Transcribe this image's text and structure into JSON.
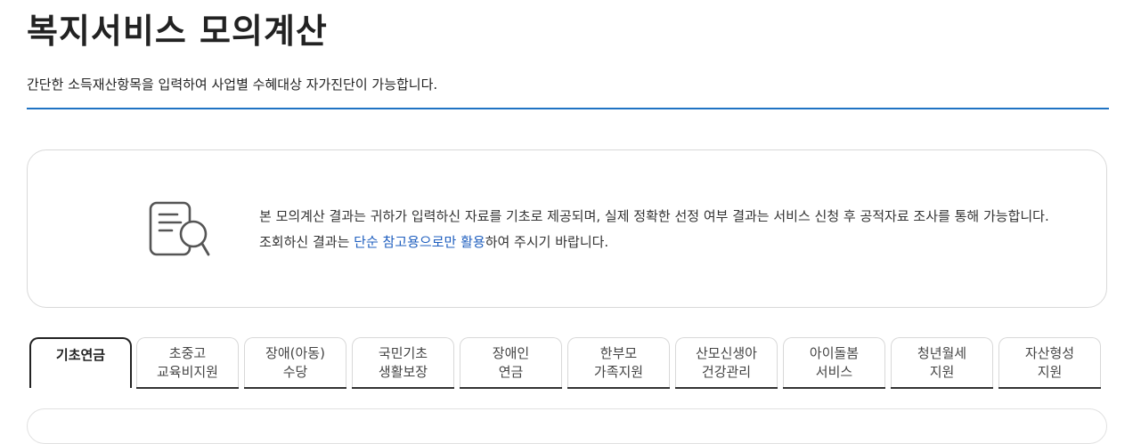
{
  "page": {
    "title": "복지서비스 모의계산",
    "subtitle": "간단한 소득재산항목을 입력하여 사업별 수혜대상 자가진단이 가능합니다."
  },
  "notice": {
    "icon": "document-search-icon",
    "text_before": "본 모의계산 결과는 귀하가 입력하신 자료를 기초로 제공되며, 실제 정확한 선정 여부 결과는 서비스 신청 후 공적자료 조사를 통해 가능합니다. 조회하신 결과는 ",
    "text_highlight": "단순 참고용으로만 활용",
    "text_after": "하여 주시기 바랍니다."
  },
  "tabs": [
    {
      "line1": "기초연금",
      "line2": ""
    },
    {
      "line1": "초중고",
      "line2": "교육비지원"
    },
    {
      "line1": "장애(아동)",
      "line2": "수당"
    },
    {
      "line1": "국민기초",
      "line2": "생활보장"
    },
    {
      "line1": "장애인",
      "line2": "연금"
    },
    {
      "line1": "한부모",
      "line2": "가족지원"
    },
    {
      "line1": "산모신생아",
      "line2": "건강관리"
    },
    {
      "line1": "아이돌봄",
      "line2": "서비스"
    },
    {
      "line1": "청년월세",
      "line2": "지원"
    },
    {
      "line1": "자산형성",
      "line2": "지원"
    }
  ],
  "colors": {
    "accent": "#1f73c3",
    "highlight": "#1f5fbf"
  }
}
